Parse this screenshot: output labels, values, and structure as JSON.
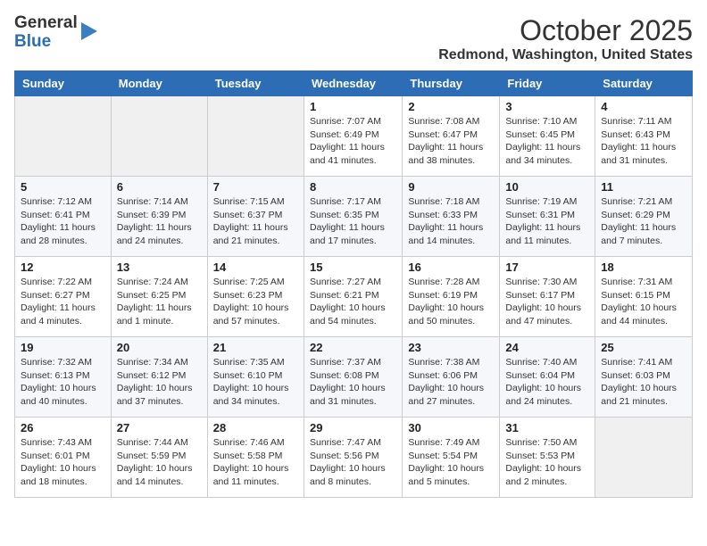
{
  "header": {
    "logo_line1": "General",
    "logo_line2": "Blue",
    "month": "October 2025",
    "location": "Redmond, Washington, United States"
  },
  "weekdays": [
    "Sunday",
    "Monday",
    "Tuesday",
    "Wednesday",
    "Thursday",
    "Friday",
    "Saturday"
  ],
  "weeks": [
    [
      {
        "day": "",
        "info": ""
      },
      {
        "day": "",
        "info": ""
      },
      {
        "day": "",
        "info": ""
      },
      {
        "day": "1",
        "info": "Sunrise: 7:07 AM\nSunset: 6:49 PM\nDaylight: 11 hours\nand 41 minutes."
      },
      {
        "day": "2",
        "info": "Sunrise: 7:08 AM\nSunset: 6:47 PM\nDaylight: 11 hours\nand 38 minutes."
      },
      {
        "day": "3",
        "info": "Sunrise: 7:10 AM\nSunset: 6:45 PM\nDaylight: 11 hours\nand 34 minutes."
      },
      {
        "day": "4",
        "info": "Sunrise: 7:11 AM\nSunset: 6:43 PM\nDaylight: 11 hours\nand 31 minutes."
      }
    ],
    [
      {
        "day": "5",
        "info": "Sunrise: 7:12 AM\nSunset: 6:41 PM\nDaylight: 11 hours\nand 28 minutes."
      },
      {
        "day": "6",
        "info": "Sunrise: 7:14 AM\nSunset: 6:39 PM\nDaylight: 11 hours\nand 24 minutes."
      },
      {
        "day": "7",
        "info": "Sunrise: 7:15 AM\nSunset: 6:37 PM\nDaylight: 11 hours\nand 21 minutes."
      },
      {
        "day": "8",
        "info": "Sunrise: 7:17 AM\nSunset: 6:35 PM\nDaylight: 11 hours\nand 17 minutes."
      },
      {
        "day": "9",
        "info": "Sunrise: 7:18 AM\nSunset: 6:33 PM\nDaylight: 11 hours\nand 14 minutes."
      },
      {
        "day": "10",
        "info": "Sunrise: 7:19 AM\nSunset: 6:31 PM\nDaylight: 11 hours\nand 11 minutes."
      },
      {
        "day": "11",
        "info": "Sunrise: 7:21 AM\nSunset: 6:29 PM\nDaylight: 11 hours\nand 7 minutes."
      }
    ],
    [
      {
        "day": "12",
        "info": "Sunrise: 7:22 AM\nSunset: 6:27 PM\nDaylight: 11 hours\nand 4 minutes."
      },
      {
        "day": "13",
        "info": "Sunrise: 7:24 AM\nSunset: 6:25 PM\nDaylight: 11 hours\nand 1 minute."
      },
      {
        "day": "14",
        "info": "Sunrise: 7:25 AM\nSunset: 6:23 PM\nDaylight: 10 hours\nand 57 minutes."
      },
      {
        "day": "15",
        "info": "Sunrise: 7:27 AM\nSunset: 6:21 PM\nDaylight: 10 hours\nand 54 minutes."
      },
      {
        "day": "16",
        "info": "Sunrise: 7:28 AM\nSunset: 6:19 PM\nDaylight: 10 hours\nand 50 minutes."
      },
      {
        "day": "17",
        "info": "Sunrise: 7:30 AM\nSunset: 6:17 PM\nDaylight: 10 hours\nand 47 minutes."
      },
      {
        "day": "18",
        "info": "Sunrise: 7:31 AM\nSunset: 6:15 PM\nDaylight: 10 hours\nand 44 minutes."
      }
    ],
    [
      {
        "day": "19",
        "info": "Sunrise: 7:32 AM\nSunset: 6:13 PM\nDaylight: 10 hours\nand 40 minutes."
      },
      {
        "day": "20",
        "info": "Sunrise: 7:34 AM\nSunset: 6:12 PM\nDaylight: 10 hours\nand 37 minutes."
      },
      {
        "day": "21",
        "info": "Sunrise: 7:35 AM\nSunset: 6:10 PM\nDaylight: 10 hours\nand 34 minutes."
      },
      {
        "day": "22",
        "info": "Sunrise: 7:37 AM\nSunset: 6:08 PM\nDaylight: 10 hours\nand 31 minutes."
      },
      {
        "day": "23",
        "info": "Sunrise: 7:38 AM\nSunset: 6:06 PM\nDaylight: 10 hours\nand 27 minutes."
      },
      {
        "day": "24",
        "info": "Sunrise: 7:40 AM\nSunset: 6:04 PM\nDaylight: 10 hours\nand 24 minutes."
      },
      {
        "day": "25",
        "info": "Sunrise: 7:41 AM\nSunset: 6:03 PM\nDaylight: 10 hours\nand 21 minutes."
      }
    ],
    [
      {
        "day": "26",
        "info": "Sunrise: 7:43 AM\nSunset: 6:01 PM\nDaylight: 10 hours\nand 18 minutes."
      },
      {
        "day": "27",
        "info": "Sunrise: 7:44 AM\nSunset: 5:59 PM\nDaylight: 10 hours\nand 14 minutes."
      },
      {
        "day": "28",
        "info": "Sunrise: 7:46 AM\nSunset: 5:58 PM\nDaylight: 10 hours\nand 11 minutes."
      },
      {
        "day": "29",
        "info": "Sunrise: 7:47 AM\nSunset: 5:56 PM\nDaylight: 10 hours\nand 8 minutes."
      },
      {
        "day": "30",
        "info": "Sunrise: 7:49 AM\nSunset: 5:54 PM\nDaylight: 10 hours\nand 5 minutes."
      },
      {
        "day": "31",
        "info": "Sunrise: 7:50 AM\nSunset: 5:53 PM\nDaylight: 10 hours\nand 2 minutes."
      },
      {
        "day": "",
        "info": ""
      }
    ]
  ]
}
